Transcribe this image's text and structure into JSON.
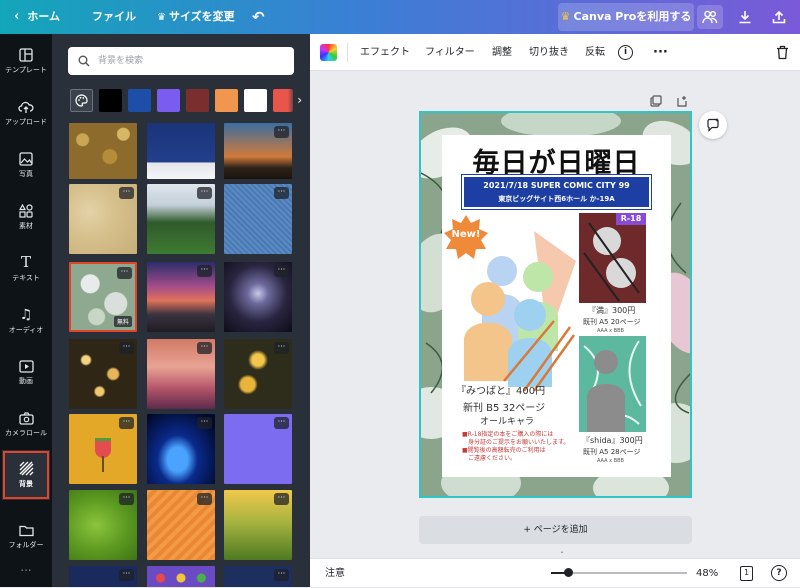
{
  "topbar": {
    "home": "ホーム",
    "file": "ファイル",
    "resize": "サイズを変更",
    "pro_button": "Canva Proを利用する",
    "home_icon": "chevron-left-icon",
    "crown_icon": "crown-icon",
    "undo_icon": "undo-icon",
    "share_icon": "people-icon",
    "download_icon": "download-icon",
    "upload_icon": "upload-icon"
  },
  "sidebar": {
    "items": [
      {
        "label": "テンプレート",
        "icon": "template-icon"
      },
      {
        "label": "アップロード",
        "icon": "upload-cloud-icon"
      },
      {
        "label": "写真",
        "icon": "photo-icon"
      },
      {
        "label": "素材",
        "icon": "elements-icon"
      },
      {
        "label": "テキスト",
        "icon": "text-icon"
      },
      {
        "label": "オーディオ",
        "icon": "music-icon"
      },
      {
        "label": "動画",
        "icon": "video-icon"
      },
      {
        "label": "カメラロール",
        "icon": "camera-icon"
      },
      {
        "label": "背景",
        "icon": "background-icon"
      },
      {
        "label": "フォルダー",
        "icon": "folder-icon"
      }
    ],
    "active_index": 8,
    "more": "..."
  },
  "panel": {
    "search_placeholder": "背景を検索",
    "swatches": [
      "#000000",
      "#1d4ea8",
      "#7b5cf0",
      "#7a2e2e",
      "#f1964f",
      "#ffffff",
      "#e8554b"
    ],
    "free_label": "無料",
    "dots": "···",
    "selected_tile": 3
  },
  "editor_toolbar": {
    "effect": "エフェクト",
    "filter": "フィルター",
    "adjust": "調整",
    "crop": "切り抜き",
    "flip": "反転",
    "info_icon": "info-icon",
    "more": "···",
    "trash_icon": "trash-icon"
  },
  "design": {
    "title": "毎日が日曜日",
    "event_line1": "2021/7/18 SUPER COMIC CITY 99",
    "event_line2": "東京ビッグサイト西6ホール か-19A",
    "new_badge": "New!",
    "r18_badge": "R-18",
    "book1_title": "『みつばと』400円",
    "book1_sub": "新刊 B5 32ページ",
    "book1_sub2": "オールキャラ",
    "book2_title": "『満』300円",
    "book2_sub": "既刊 A5 20ページ",
    "book2_sub2": "AAA x BBB",
    "book3_title": "『shida』300円",
    "book3_sub": "既刊 A5 28ページ",
    "book3_sub2": "AAA x BBB",
    "notes": [
      "■R-18指定の本をご購入の際には",
      "　身分証のご提示をお願いいたします。",
      "■閲覧後の高額転売のご利用は",
      "　ご遠慮ください。"
    ]
  },
  "canvas": {
    "add_page": "+ ページを追加"
  },
  "status": {
    "notes": "注意",
    "zoom": "48%",
    "page": "1",
    "help": "?"
  },
  "colors": {
    "accent_cyan": "#2ec4c8",
    "sidebar_bg": "#0e1318",
    "panel_bg": "#293039",
    "selection_red": "#e0452a",
    "design_blue": "#1d3fa3",
    "badge_orange": "#ef8a3a",
    "badge_purple": "#8a4bd4"
  }
}
